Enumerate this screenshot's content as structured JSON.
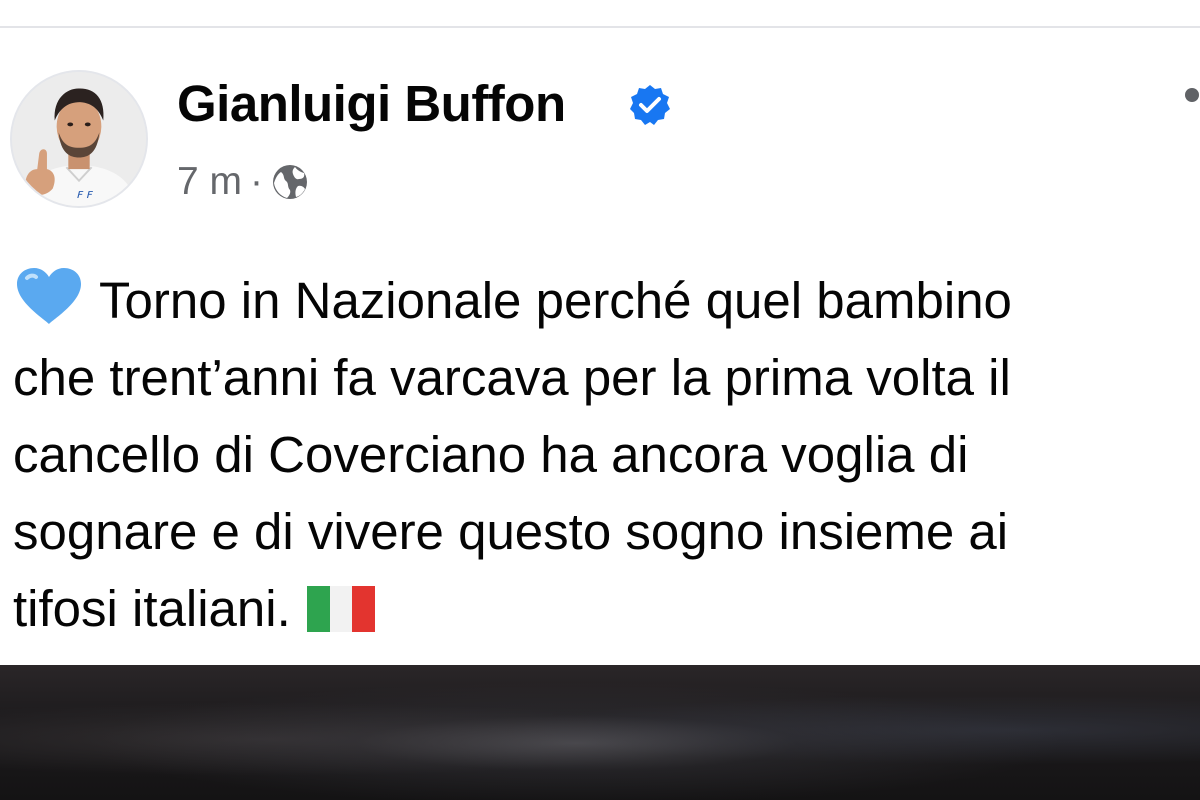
{
  "post": {
    "author": {
      "name": "Gianluigi Buffon",
      "verified": true,
      "avatar": "profile-photo"
    },
    "time": "7 m",
    "separator": "·",
    "audience_icon": "globe-icon",
    "more_icon": "more-options-icon",
    "text_lines": [
      "Torno in Nazionale perché quel bambino",
      "che trent’anni fa varcava per la prima volta il",
      "cancello di Coverciano ha ancora voglia di",
      "sognare e di vivere questo sogno insieme ai",
      "tifosi italiani."
    ],
    "leading_emoji": "blue-heart-icon",
    "trailing_emoji": "italy-flag-icon",
    "media": "post-photo"
  },
  "colors": {
    "verified_badge": "#1877f2",
    "meta_text": "#65676b",
    "heart": "#5aa9f0",
    "flag_green": "#2ea44f",
    "flag_white": "#f2f2f2",
    "flag_red": "#e3342f"
  }
}
